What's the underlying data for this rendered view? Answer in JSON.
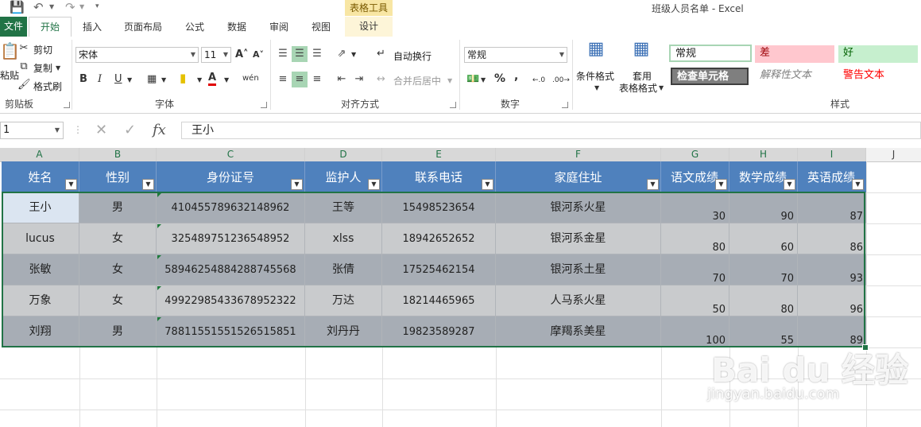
{
  "title_bar": {
    "window_title": "班级人员名单 - Excel",
    "context_group": "表格工具",
    "qat": {
      "save_icon": "save-icon",
      "undo_icon": "undo-icon",
      "redo_icon": "redo-icon",
      "customize_icon": "chevron-down-icon"
    }
  },
  "tabs": {
    "file": "文件",
    "home": "开始",
    "insert": "插入",
    "page_layout": "页面布局",
    "formulas": "公式",
    "data": "数据",
    "review": "审阅",
    "view": "视图",
    "design": "设计"
  },
  "ribbon": {
    "clipboard": {
      "paste": "粘贴",
      "cut": "剪切",
      "copy": "复制",
      "format_painter": "格式刷",
      "label": "剪贴板"
    },
    "font": {
      "font_name": "宋体",
      "font_size": "11",
      "label": "字体",
      "bold": "B",
      "italic": "I",
      "underline": "U",
      "grow": "A˄",
      "shrink": "A˅",
      "font_color_glyph": "A",
      "phonetic": "wén"
    },
    "alignment": {
      "wrap_text": "自动换行",
      "merge_center": "合并后居中",
      "label": "对齐方式"
    },
    "number": {
      "format": "常规",
      "percent": "%",
      "comma": ",",
      "label": "数字",
      "inc_decimal": "←.0",
      "dec_decimal": ".00→"
    },
    "styles": {
      "conditional_format": "条件格式",
      "table_format_line1": "套用",
      "table_format_line2": "表格格式",
      "normal": "常规",
      "bad": "差",
      "good": "好",
      "check_cell": "检查单元格",
      "explanatory": "解释性文本",
      "warning": "警告文本",
      "label": "样式"
    },
    "colors": {
      "active_green": "#a8d5b4",
      "bad_bg": "#ffc7ce",
      "bad_fg": "#9c0006",
      "good_bg": "#c6efce",
      "good_fg": "#006100",
      "warning_fg": "#ff0000"
    }
  },
  "formula_bar": {
    "name_box": "1",
    "cancel_icon": "close-icon",
    "enter_icon": "check-icon",
    "fx": "fx",
    "value": "王小"
  },
  "grid": {
    "columns": [
      "A",
      "B",
      "C",
      "D",
      "E",
      "F",
      "G",
      "H",
      "I",
      "J"
    ],
    "headers": [
      "姓名",
      "性别",
      "身份证号",
      "监护人",
      "联系电话",
      "家庭住址",
      "语文成绩",
      "数学成绩",
      "英语成绩"
    ],
    "rows": [
      [
        "王小",
        "男",
        "410455789632148962",
        "王等",
        "15498523654",
        "银河系火星",
        "30",
        "90",
        "87"
      ],
      [
        "lucus",
        "女",
        "325489751236548952",
        "xlss",
        "18942652652",
        "银河系金星",
        "80",
        "60",
        "86"
      ],
      [
        "张敏",
        "女",
        "58946254884288745568",
        "张倩",
        "17525462154",
        "银河系土星",
        "70",
        "70",
        "93"
      ],
      [
        "万象",
        "女",
        "49922985433678952322",
        "万达",
        "18214465965",
        "人马系火星",
        "50",
        "80",
        "96"
      ],
      [
        "刘翔",
        "男",
        "78811551551526515851",
        "刘丹丹",
        "19823589287",
        "摩羯系美星",
        "100",
        "55",
        "89"
      ]
    ],
    "header_color": "#4f81bd"
  },
  "watermark": {
    "main": "Bai du 经验",
    "sub": "jingyan.baidu.com"
  }
}
